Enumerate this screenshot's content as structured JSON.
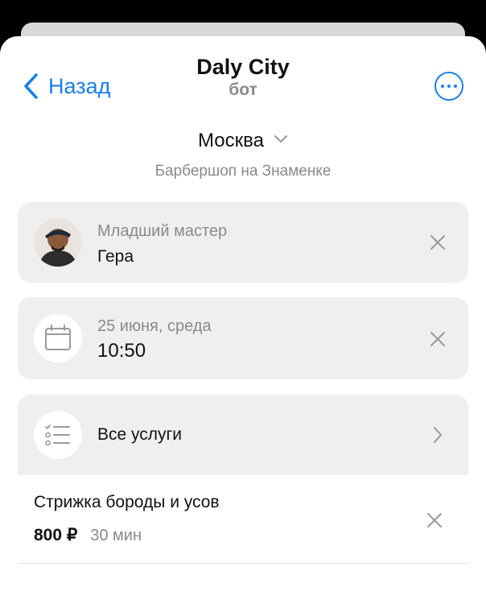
{
  "header": {
    "back_label": "Назад",
    "title": "Daly City",
    "subtitle": "бот"
  },
  "location": {
    "city": "Москва",
    "branch": "Барбершоп на Знаменке"
  },
  "master": {
    "role": "Младший мастер",
    "name": "Гера"
  },
  "datetime": {
    "date": "25 июня, среда",
    "time": "10:50"
  },
  "services": {
    "all_label": "Все услуги",
    "items": [
      {
        "name": "Стрижка бороды и усов",
        "price": "800 ₽",
        "duration": "30 мин"
      }
    ]
  },
  "colors": {
    "accent": "#1a7fe8",
    "card_bg": "#efefef",
    "muted_text": "#8a8a8a"
  }
}
